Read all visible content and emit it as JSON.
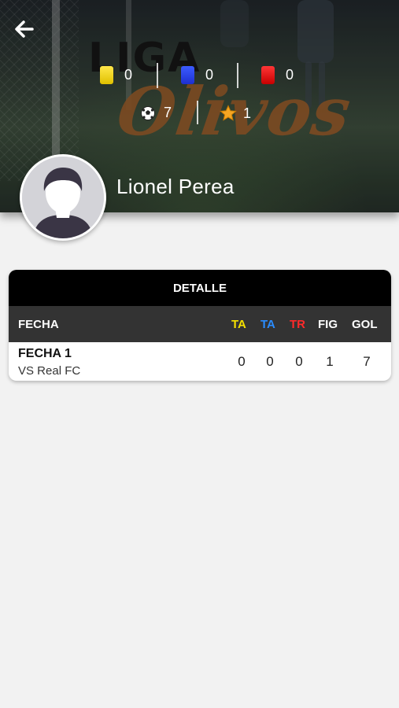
{
  "header": {
    "back_icon": "arrow-left-icon",
    "logo_line1": "LIGA",
    "logo_line2": "Olivos"
  },
  "stats": {
    "yellow_cards": "0",
    "blue_cards": "0",
    "red_cards": "0",
    "goals": "7",
    "mvp_awards": "1",
    "colors": {
      "yellow": "#ffe84a",
      "blue": "#3c5cff",
      "red": "#ff3636"
    }
  },
  "player": {
    "name": "Lionel Perea",
    "avatar_icon": "user-silhouette-icon"
  },
  "detail": {
    "title": "DETALLE",
    "columns": {
      "fecha": "FECHA",
      "ta_yellow": "TA",
      "ta_blue": "TA",
      "tr": "TR",
      "fig": "FIG",
      "gol": "GOL"
    },
    "column_colors": {
      "ta_yellow": "#f5e000",
      "ta_blue": "#2a8cff",
      "tr": "#ff2a2a"
    },
    "rows": [
      {
        "fecha": "FECHA 1",
        "rival": "VS Real FC",
        "ta_yellow": "0",
        "ta_blue": "0",
        "tr": "0",
        "fig": "1",
        "gol": "7"
      }
    ]
  }
}
